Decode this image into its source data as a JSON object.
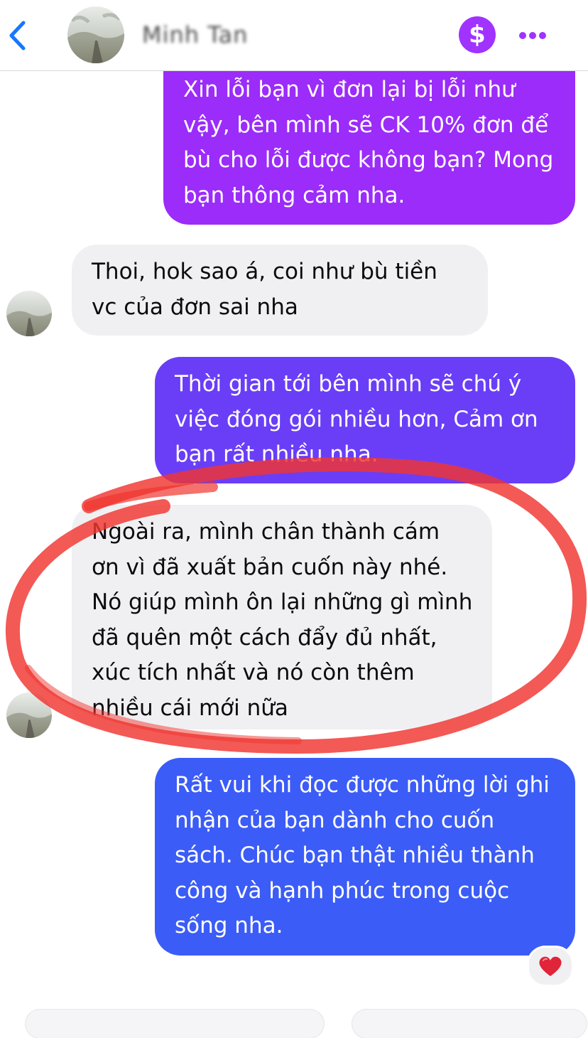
{
  "header": {
    "contact_name": "Minh Tan",
    "back_icon": "chevron-left-icon",
    "payment_icon": "dollar-icon",
    "payment_symbol": "$",
    "more_icon": "more-dots-icon",
    "accent_color": "#a033ff"
  },
  "messages": [
    {
      "sender": "me",
      "text": "Xin lỗi bạn vì đơn lại bị lỗi như vậy, bên mình sẽ CK 10% đơn để bù cho lỗi được không bạn? Mong bạn thông cảm nha."
    },
    {
      "sender": "them",
      "text": "Thoi, hok sao á, coi như bù tiền vc của đơn sai nha"
    },
    {
      "sender": "me",
      "text": "Thời gian tới bên mình sẽ chú ý việc đóng gói nhiều hơn, Cảm ơn bạn rất nhiều nha."
    },
    {
      "sender": "them",
      "text": "Ngoài ra, mình chân thành cám ơn vì đã xuất bản cuốn này nhé. Nó giúp mình ôn lại những gì mình đã quên một cách đẩy đủ nhất, xúc tích nhất và nó còn thêm nhiều cái mới nữa"
    },
    {
      "sender": "me",
      "text": "Rất vui khi đọc được những lời ghi nhận của bạn dành cho cuốn sách. Chúc bạn thật nhiều thành công và hạnh phúc trong cuộc sống nha."
    }
  ],
  "reaction": {
    "icon": "red-heart-icon",
    "color": "#e0243a"
  },
  "bubble_colors": {
    "top": "#9b2cf9",
    "middle": "#6a3ef7",
    "bottom": "#3b5cf6",
    "incoming": "#f0f0f3"
  },
  "annotation": {
    "color": "#f0352f",
    "shape": "hand-drawn-circle"
  }
}
